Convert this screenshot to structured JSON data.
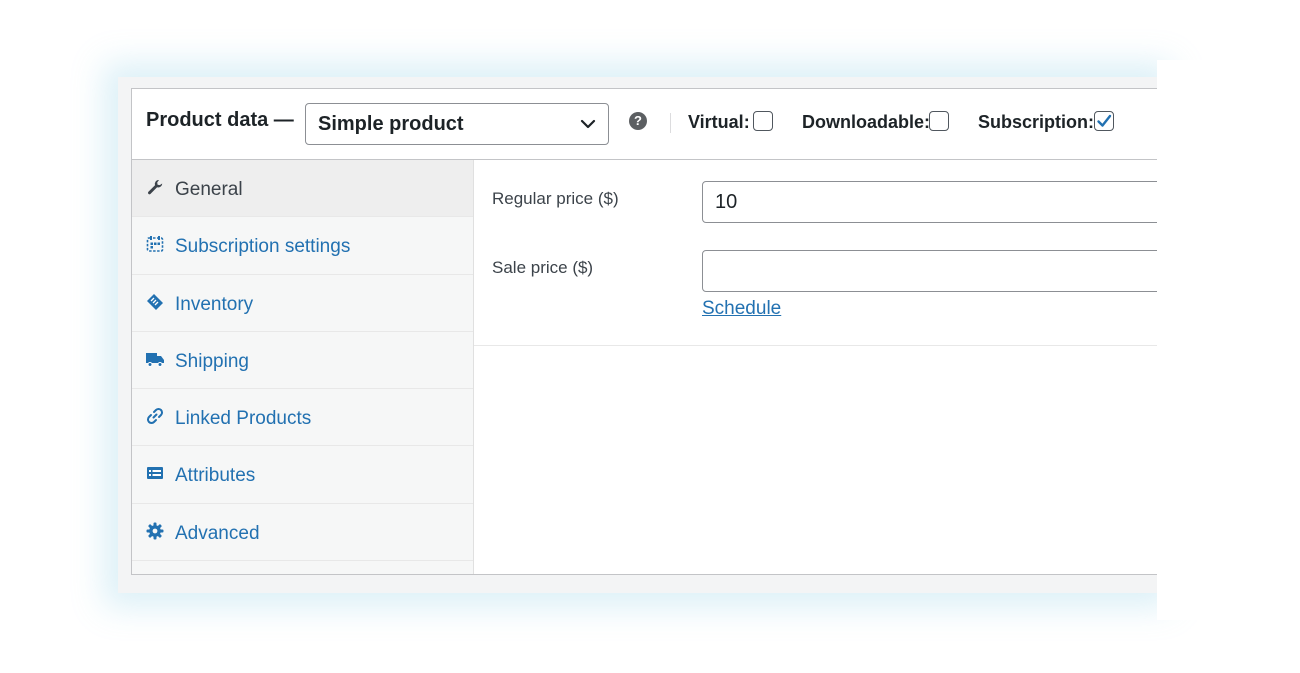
{
  "header": {
    "title": "Product data —",
    "product_type": "Simple product",
    "help": "?",
    "options": [
      {
        "label": "Virtual:",
        "checked": false
      },
      {
        "label": "Downloadable:",
        "checked": false
      },
      {
        "label": "Subscription:",
        "checked": true
      }
    ]
  },
  "tabs": [
    {
      "label": "General",
      "icon": "wrench-icon",
      "active": true
    },
    {
      "label": "Subscription settings",
      "icon": "calendar-icon",
      "active": false
    },
    {
      "label": "Inventory",
      "icon": "tag-icon",
      "active": false
    },
    {
      "label": "Shipping",
      "icon": "truck-icon",
      "active": false
    },
    {
      "label": "Linked Products",
      "icon": "link-icon",
      "active": false
    },
    {
      "label": "Attributes",
      "icon": "list-icon",
      "active": false
    },
    {
      "label": "Advanced",
      "icon": "gear-icon",
      "active": false
    }
  ],
  "general": {
    "regular_price_label": "Regular price ($)",
    "regular_price_value": "10",
    "sale_price_label": "Sale price ($)",
    "sale_price_value": "",
    "schedule_link": "Schedule"
  },
  "colors": {
    "link": "#2271b1",
    "active_tab_bg": "#eeeeee",
    "sidebar_bg": "#f6f7f7",
    "check": "#2271b1"
  }
}
